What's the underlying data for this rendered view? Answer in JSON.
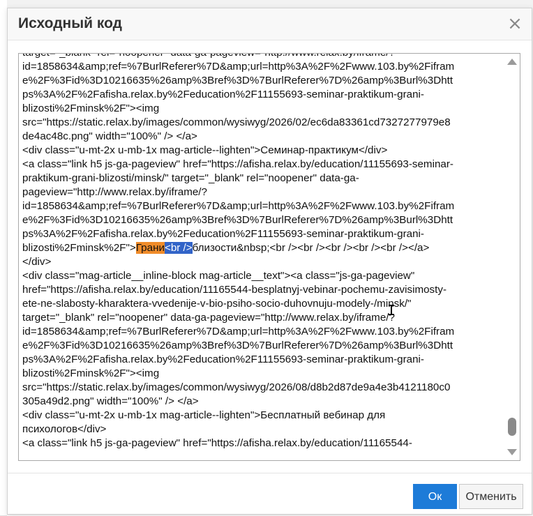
{
  "dialog": {
    "title": "Исходный код",
    "close_glyph": "×",
    "ok_label": "Ок",
    "cancel_label": "Отменить"
  },
  "editor": {
    "lines": [
      "target=\"_blank\" rel=\"noopener\" data-ga-pageview=\"http://www.relax.by/iframe/?",
      "id=1858634&amp;ref=%7BurlReferer%7D&amp;url=http%3A%2F%2Fwww.103.by%2Fifram",
      "e%2F%3Fid%3D10216635%26amp%3Bref%3D%7BurlReferer%7D%26amp%3Burl%3Dhtt",
      "ps%3A%2F%2Fafisha.relax.by%2Feducation%2F11155693-seminar-praktikum-grani-",
      "blizosti%2Fminsk%2F\"><img",
      "src=\"https://static.relax.by/images/common/wysiwyg/2026/02/ec6da83361cd7327277979e8",
      "de4ac48c.png\" width=\"100%\" /> </a>",
      "<div class=\"u-mt-2x u-mb-1x mag-article--lighten\">Семинар-практикум</div>",
      "<a class=\"link h5 js-ga-pageview\" href=\"https://afisha.relax.by/education/11155693-seminar-",
      "praktikum-grani-blizosti/minsk/\" target=\"_blank\" rel=\"noopener\" data-ga-",
      "pageview=\"http://www.relax.by/iframe/?",
      "id=1858634&amp;ref=%7BurlReferer%7D&amp;url=http%3A%2F%2Fwww.103.by%2Fifram",
      "e%2F%3Fid%3D10216635%26amp%3Bref%3D%7BurlReferer%7D%26amp%3Burl%3Dhtt",
      "ps%3A%2F%2Fafisha.relax.by%2Feducation%2F11155693-seminar-praktikum-grani-",
      "",
      "</div>",
      "<div class=\"mag-article__inline-block mag-article__text\"><a class=\"js-ga-pageview\"",
      "href=\"https://afisha.relax.by/education/11165544-besplatnyj-vebinar-pochemu-zavisimosty-",
      "ete-ne-slabosty-kharaktera-vvedenije-v-bio-psiho-socio-duhovnuju-modely-/minsk/\"",
      "target=\"_blank\" rel=\"noopener\" data-ga-pageview=\"http://www.relax.by/iframe/?",
      "id=1858634&amp;ref=%7BurlReferer%7D&amp;url=http%3A%2F%2Fwww.103.by%2Fifram",
      "e%2F%3Fid%3D10216635%26amp%3Bref%3D%7BurlReferer%7D%26amp%3Burl%3Dhtt",
      "ps%3A%2F%2Fafisha.relax.by%2Feducation%2F11155693-seminar-praktikum-grani-",
      "blizosti%2Fminsk%2F\"><img",
      "src=\"https://static.relax.by/images/common/wysiwyg/2026/08/d8b2d87de9a4e3b4121180c0",
      "305a49d2.png\" width=\"100%\" /> </a>",
      "<div class=\"u-mt-2x u-mb-1x mag-article--lighten\">Бесплатный вебинар для",
      "психологов</div>",
      "<a class=\"link h5 js-ga-pageview\" href=\"https://afisha.relax.by/education/11165544-"
    ],
    "highlight_line": {
      "prefix": "blizosti%2Fminsk%2F\">",
      "orange_text": "Грани",
      "blue_text": "<br />",
      "suffix": "близости&nbsp;<br /><br /><br /><br /><br /></a>"
    },
    "cursor_glyph": "I"
  },
  "colors": {
    "ok_button": "#1d7bd8",
    "highlight_orange": "#f08c2a",
    "highlight_blue": "#3264c8"
  }
}
